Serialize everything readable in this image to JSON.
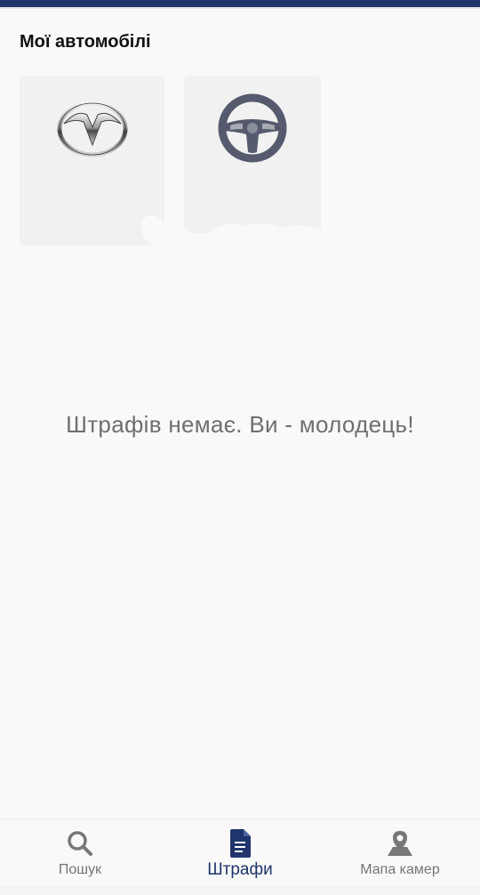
{
  "header": {
    "title": "Мої автомобілі"
  },
  "cars": [
    {
      "icon": "mazda-logo-icon"
    },
    {
      "icon": "steering-wheel-icon"
    }
  ],
  "fines": {
    "empty_message": "Штрафів немає. Ви - молодець!"
  },
  "bottom_nav": {
    "items": [
      {
        "label": "Пошук",
        "icon": "search-icon"
      },
      {
        "label": "Штрафи",
        "icon": "document-icon",
        "active": true
      },
      {
        "label": "Мапа камер",
        "icon": "map-pin-icon"
      }
    ]
  },
  "colors": {
    "accent": "#1f356b",
    "inactive": "#757575",
    "card_bg": "#f1f1f1"
  }
}
